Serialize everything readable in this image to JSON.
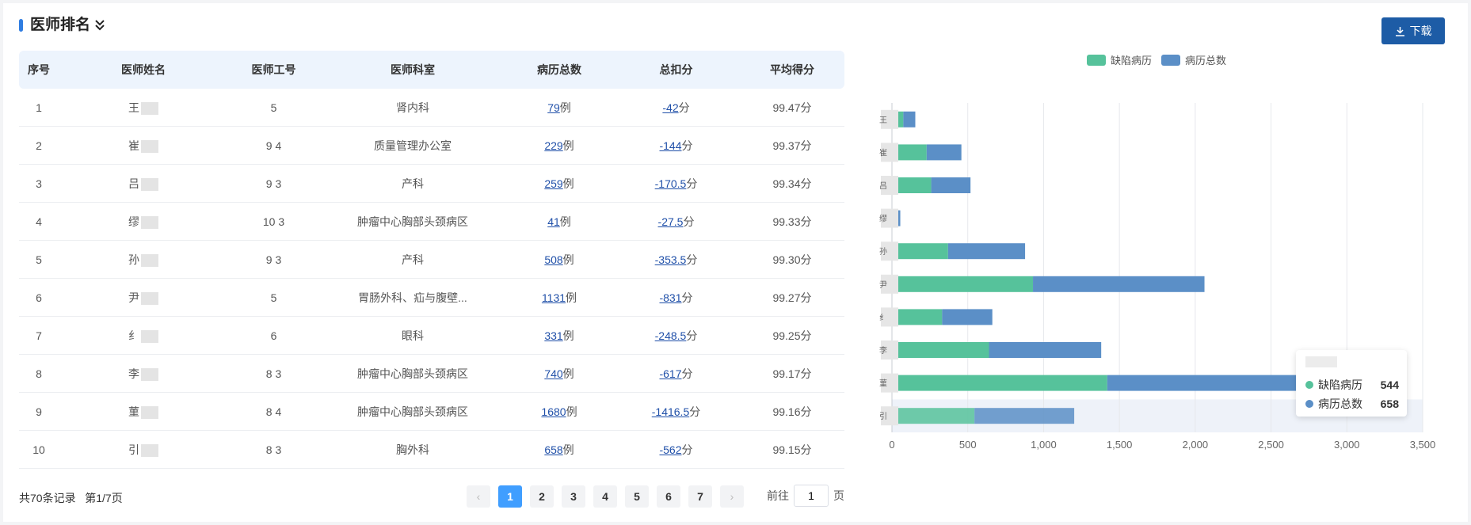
{
  "header": {
    "title": "医师排名",
    "download_label": "下载"
  },
  "table": {
    "columns": [
      "序号",
      "医师姓名",
      "医师工号",
      "医师科室",
      "病历总数",
      "总扣分",
      "平均得分"
    ],
    "rows": [
      {
        "no": "1",
        "name": "王",
        "id": "5",
        "dept": "肾内科",
        "cases": "79",
        "cases_unit": "例",
        "deduct": "-42",
        "deduct_unit": "分",
        "avg": "99.47分"
      },
      {
        "no": "2",
        "name": "崔",
        "id": "9 4",
        "dept": "质量管理办公室",
        "cases": "229",
        "cases_unit": "例",
        "deduct": "-144",
        "deduct_unit": "分",
        "avg": "99.37分"
      },
      {
        "no": "3",
        "name": "吕",
        "id": "9 3",
        "dept": "产科",
        "cases": "259",
        "cases_unit": "例",
        "deduct": "-170.5",
        "deduct_unit": "分",
        "avg": "99.34分"
      },
      {
        "no": "4",
        "name": "缪",
        "id": "10 3",
        "dept": "肿瘤中心胸部头颈病区",
        "cases": "41",
        "cases_unit": "例",
        "deduct": "-27.5",
        "deduct_unit": "分",
        "avg": "99.33分"
      },
      {
        "no": "5",
        "name": "孙",
        "id": "9 3",
        "dept": "产科",
        "cases": "508",
        "cases_unit": "例",
        "deduct": "-353.5",
        "deduct_unit": "分",
        "avg": "99.30分"
      },
      {
        "no": "6",
        "name": "尹",
        "id": "5",
        "dept": "胃肠外科、疝与腹壁...",
        "cases": "1131",
        "cases_unit": "例",
        "deduct": "-831",
        "deduct_unit": "分",
        "avg": "99.27分"
      },
      {
        "no": "7",
        "name": "纟",
        "id": "6",
        "dept": "眼科",
        "cases": "331",
        "cases_unit": "例",
        "deduct": "-248.5",
        "deduct_unit": "分",
        "avg": "99.25分"
      },
      {
        "no": "8",
        "name": "李",
        "id": "8 3",
        "dept": "肿瘤中心胸部头颈病区",
        "cases": "740",
        "cases_unit": "例",
        "deduct": "-617",
        "deduct_unit": "分",
        "avg": "99.17分"
      },
      {
        "no": "9",
        "name": "菫",
        "id": "8 4",
        "dept": "肿瘤中心胸部头颈病区",
        "cases": "1680",
        "cases_unit": "例",
        "deduct": "-1416.5",
        "deduct_unit": "分",
        "avg": "99.16分"
      },
      {
        "no": "10",
        "name": "引",
        "id": "8 3",
        "dept": "胸外科",
        "cases": "658",
        "cases_unit": "例",
        "deduct": "-562",
        "deduct_unit": "分",
        "avg": "99.15分"
      }
    ]
  },
  "footer": {
    "total": "共70条记录",
    "page_info": "第1/7页"
  },
  "pagination": {
    "prev": "‹",
    "pages": [
      "1",
      "2",
      "3",
      "4",
      "5",
      "6",
      "7"
    ],
    "active": "1",
    "next": "›",
    "goto_label": "前往",
    "goto_value": "1",
    "page_suffix": "页"
  },
  "legend": [
    {
      "name": "缺陷病历",
      "color": "#56c29b"
    },
    {
      "name": "病历总数",
      "color": "#5b8fc7"
    }
  ],
  "chart_data": {
    "type": "bar",
    "orientation": "horizontal",
    "stacked": true,
    "categories": [
      "王",
      "崔",
      "吕",
      "缪",
      "孙",
      "尹",
      "纟",
      "李",
      "菫",
      "引"
    ],
    "series": [
      {
        "name": "缺陷病历",
        "values": [
          75,
          229,
          259,
          14,
          370,
          930,
          331,
          640,
          1420,
          544
        ]
      },
      {
        "name": "病历总数",
        "values": [
          79,
          229,
          259,
          41,
          508,
          1131,
          331,
          740,
          1680,
          658
        ]
      }
    ],
    "xlim": [
      0,
      3500
    ],
    "xticks": [
      "0",
      "500",
      "1,000",
      "1,500",
      "2,000",
      "2,500",
      "3,000",
      "3,500"
    ],
    "grid": true,
    "legend_position": "top",
    "highlighted_category_index": 9
  },
  "tooltip": {
    "rows": [
      {
        "name": "缺陷病历",
        "value": "544",
        "color": "#56c29b"
      },
      {
        "name": "病历总数",
        "value": "658",
        "color": "#5b8fc7"
      }
    ]
  }
}
